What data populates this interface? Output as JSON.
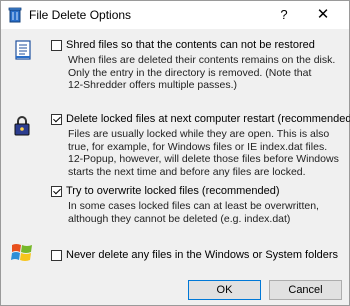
{
  "window": {
    "title": "File Delete Options",
    "help_label": "?",
    "close_label": "✕"
  },
  "options": {
    "shred": {
      "label": "Shred files so that the contents can not be restored",
      "checked": false,
      "description": "When files are deleted their contents remains on the disk.\nOnly the entry in the directory is removed. (Note that\n12-Shredder offers multiple passes.)"
    },
    "locked_restart": {
      "label": "Delete locked files at next computer restart (recommended)",
      "checked": true,
      "description": "Files are usually locked while they are open. This is also\ntrue, for example, for Windows files or IE index.dat files.\n12-Popup, however, will delete those files before Windows\nstarts the next time and before any files are locked."
    },
    "overwrite_locked": {
      "label": "Try to overwrite locked files (recommended)",
      "checked": true,
      "description": "In some cases locked files can at least be overwritten,\nalthough they cannot be deleted (e.g. index.dat)"
    },
    "never_windows": {
      "label": "Never delete any files in the Windows or System folders",
      "checked": false
    }
  },
  "buttons": {
    "ok": "OK",
    "cancel": "Cancel"
  },
  "icons": {
    "app": "trash-icon",
    "shred": "document-icon",
    "lock": "padlock-icon",
    "windows": "windows-logo-icon"
  }
}
